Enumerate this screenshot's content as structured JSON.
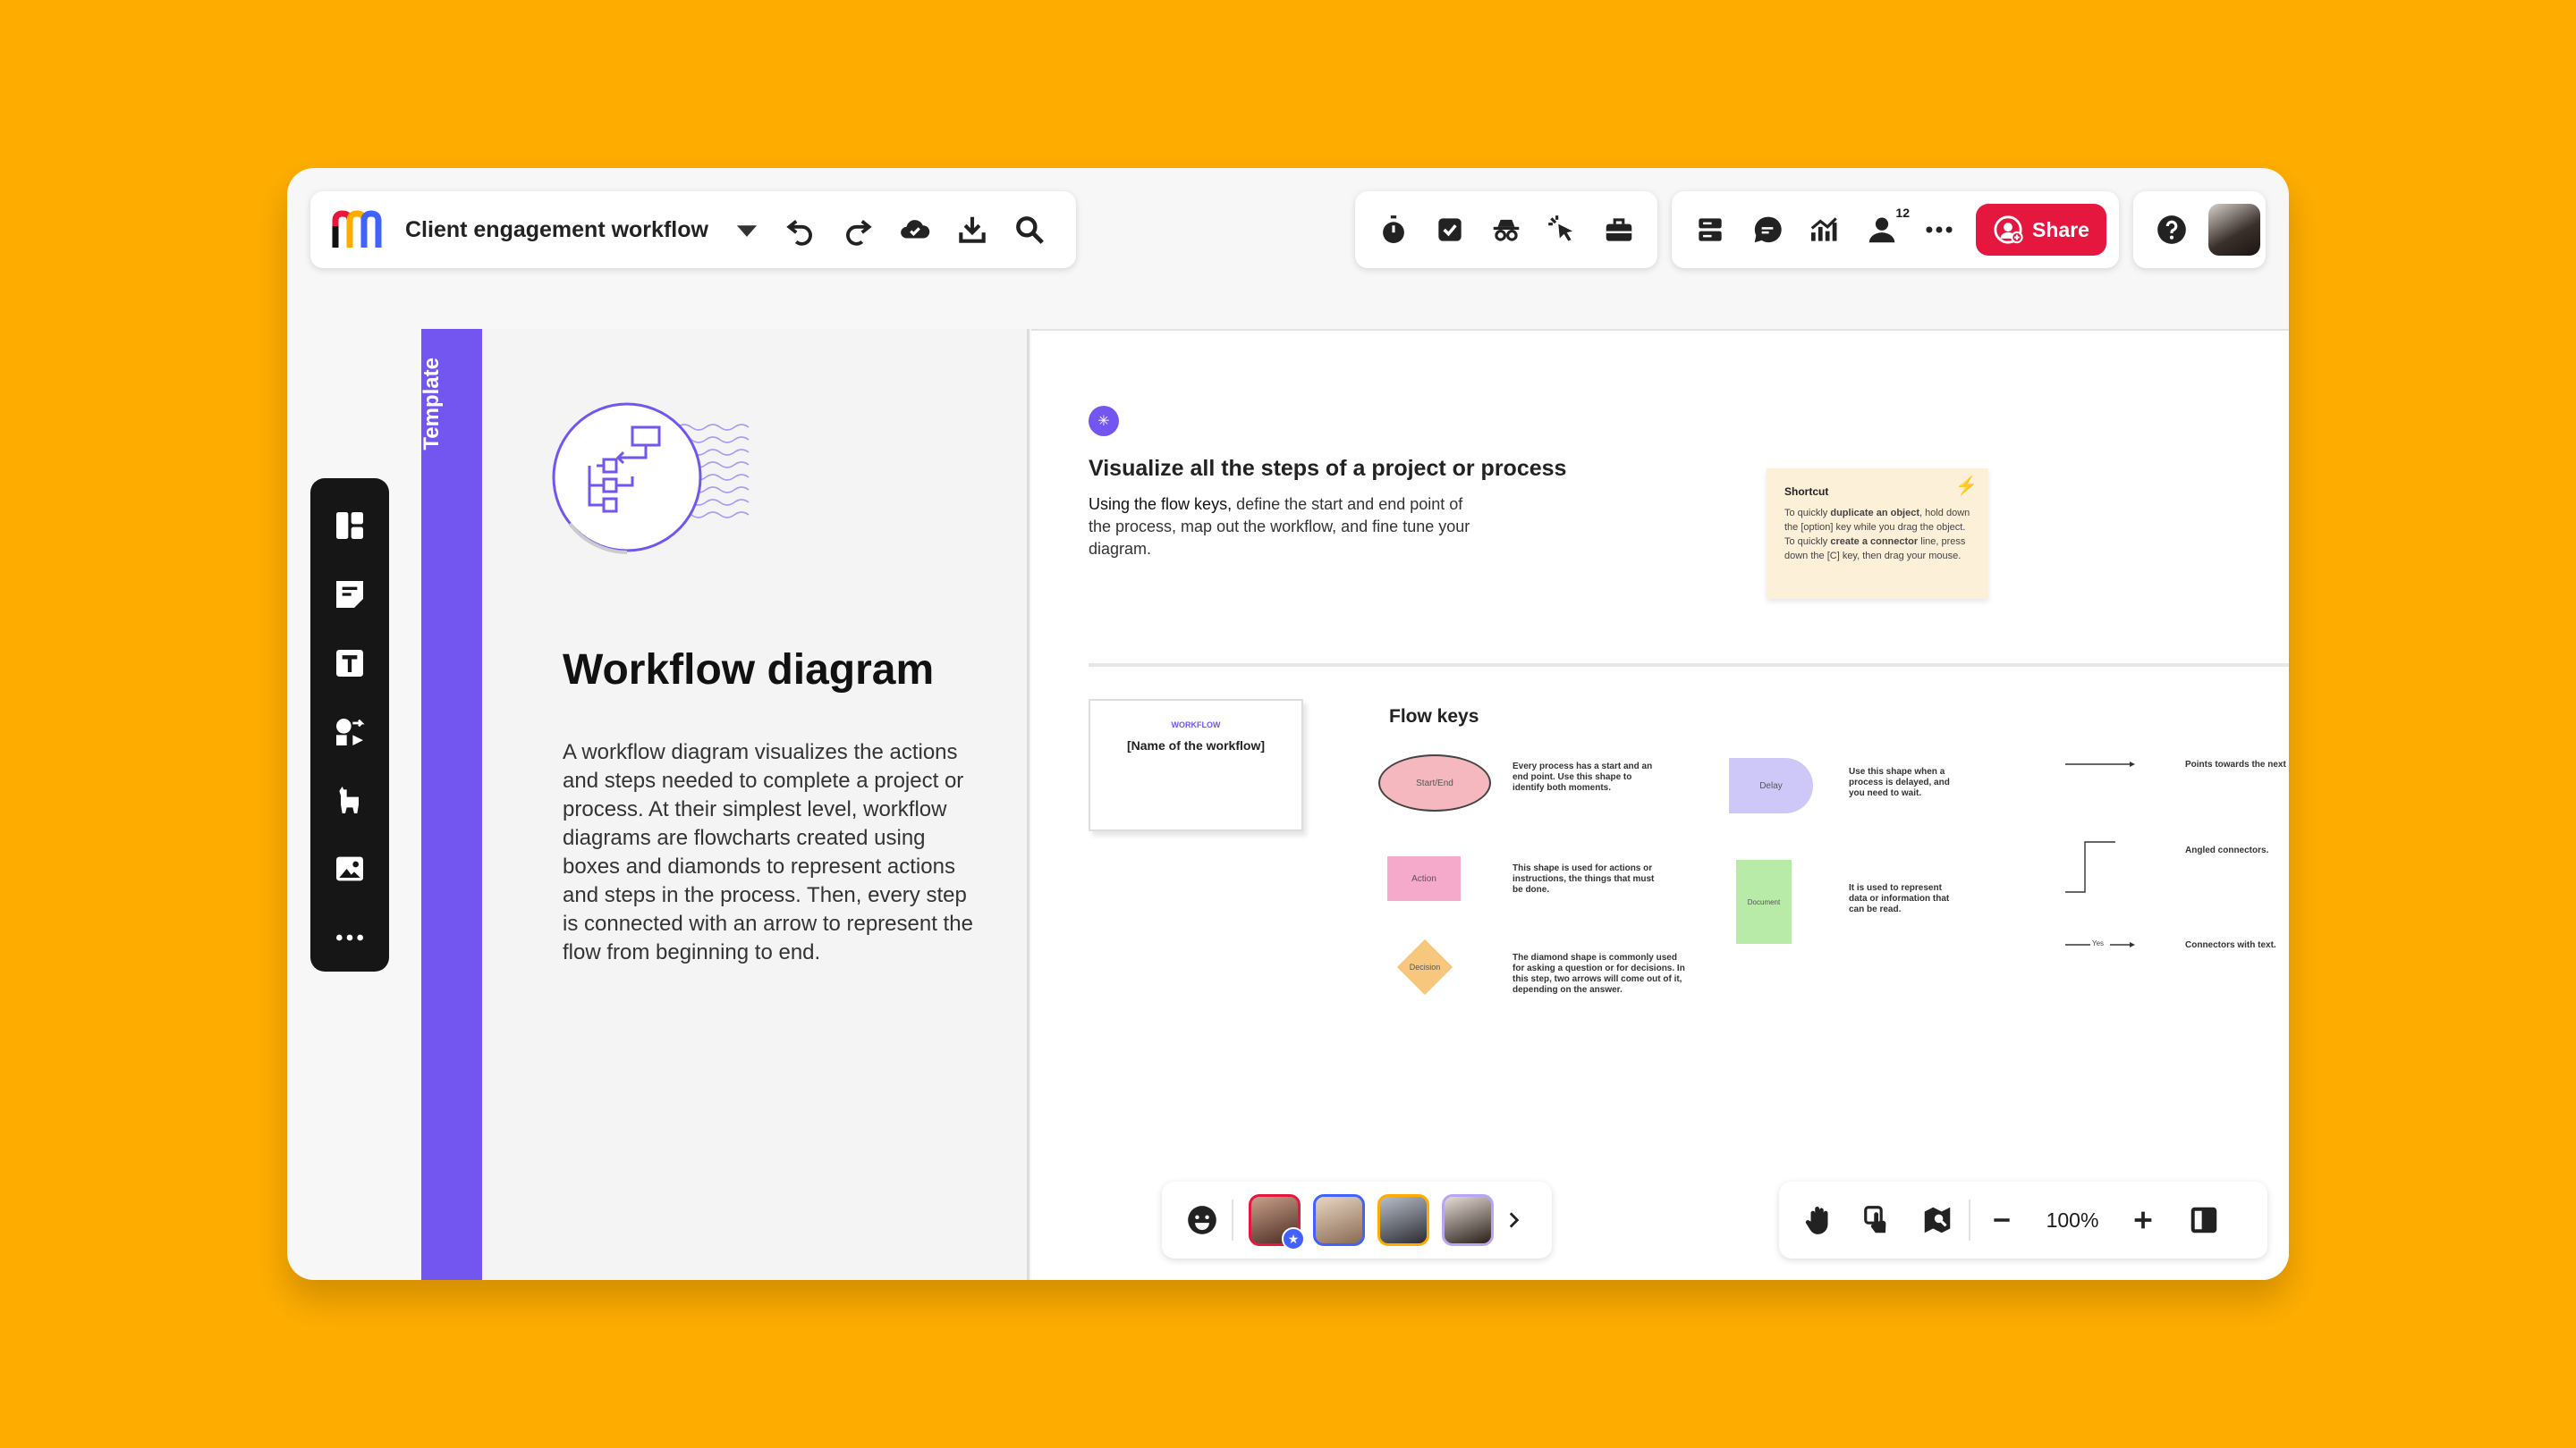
{
  "toolbar": {
    "board_title": "Client engagement workflow",
    "share_label": "Share",
    "notification_count": "12",
    "share_color": "#E5173F"
  },
  "template_strip": {
    "label": "Template",
    "color": "#7356F0"
  },
  "left_panel": {
    "title": "Workflow diagram",
    "description": "A workflow diagram visualizes the actions and steps needed to complete a project or process. At their simplest level, workflow diagrams are flowcharts created using boxes and diamonds to represent actions and steps in the process. Then, every step is connected with an arrow to represent the flow from beginning to end."
  },
  "canvas": {
    "heading": "Visualize all the steps of a project or process",
    "intro_prefix": "Using the flow keys,",
    "intro_rest": " define the start and end point of the process, map out the workflow, and fine tune your diagram.",
    "shortcut": {
      "title": "Shortcut",
      "p1": "To quickly ",
      "b1": "duplicate an object",
      "p2": ", hold down the [option] key while you drag the object. To quickly ",
      "b2": "create a connector",
      "p3": " line, press down the [C] key, then drag your mouse."
    },
    "workflow_card": {
      "label": "WORKFLOW",
      "name": "[Name of the workflow]"
    },
    "flow_keys_title": "Flow keys",
    "keys": {
      "start_end": {
        "label": "Start/End",
        "text": "Every process has a start and an end point. Use this shape to identify both moments.",
        "color": "#F4B8BE"
      },
      "action": {
        "label": "Action",
        "text": "This shape is used for actions or instructions, the things that must be done.",
        "color": "#F6AACB"
      },
      "decision": {
        "label": "Decision",
        "text": "The diamond shape is commonly used for asking a question or for decisions. In this step, two arrows will come out of it, depending on the answer.",
        "color": "#F8C77E"
      },
      "delay": {
        "label": "Delay",
        "text": "Use this shape when a process is delayed, and you need to wait.",
        "color": "#CDC8F8"
      },
      "document": {
        "label": "Document",
        "text": "It is used to represent data or information that can be read.",
        "color": "#B8EAA8"
      },
      "arrow": {
        "text": "Points towards the next step"
      },
      "angled": {
        "text": "Angled connectors."
      },
      "connector_text": {
        "label": "Yes",
        "text": "Connectors with text."
      }
    }
  },
  "zoom": {
    "level": "100%"
  }
}
